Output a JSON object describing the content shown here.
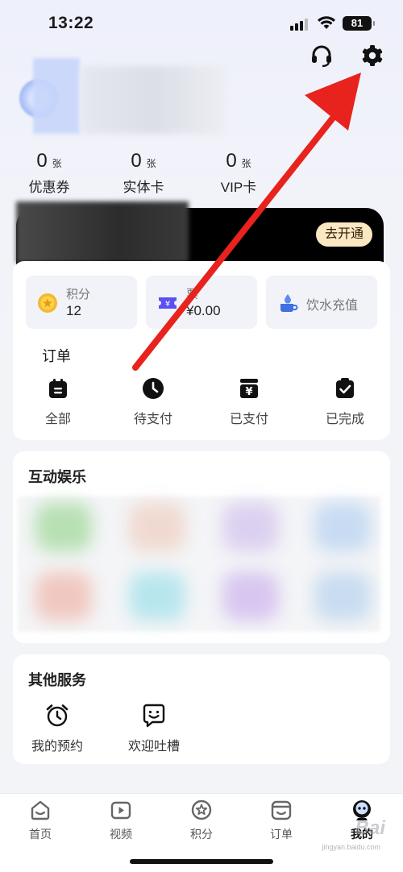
{
  "status_bar": {
    "time": "13:22",
    "battery": "81"
  },
  "stats": [
    {
      "num": "0",
      "unit": "张",
      "label": "优惠券"
    },
    {
      "num": "0",
      "unit": "张",
      "label": "实体卡"
    },
    {
      "num": "0",
      "unit": "张",
      "label": "VIP卡"
    }
  ],
  "vip": {
    "button": "去开通"
  },
  "tiles": [
    {
      "title": "积分",
      "value": "12"
    },
    {
      "title": "票",
      "value": "¥0.00"
    },
    {
      "title": "饮水充值"
    }
  ],
  "orders": {
    "title": "订单",
    "items": [
      {
        "label": "全部",
        "icon": "calendar-icon"
      },
      {
        "label": "待支付",
        "icon": "clock-icon"
      },
      {
        "label": "已支付",
        "icon": "yen-box-icon"
      },
      {
        "label": "已完成",
        "icon": "check-calendar-icon"
      }
    ]
  },
  "entertainment": {
    "title": "互动娱乐"
  },
  "services": {
    "title": "其他服务",
    "items": [
      {
        "label": "我的预约",
        "icon": "alarm-clock-icon"
      },
      {
        "label": "欢迎吐槽",
        "icon": "chat-smile-icon"
      }
    ]
  },
  "tabs": [
    {
      "label": "首页",
      "icon": "home-icon"
    },
    {
      "label": "视频",
      "icon": "video-icon"
    },
    {
      "label": "积分",
      "icon": "points-icon"
    },
    {
      "label": "订单",
      "icon": "order-icon"
    },
    {
      "label": "我的",
      "icon": "profile-icon",
      "active": true
    }
  ],
  "watermark": {
    "text": "Bai",
    "sub": "jingyan.baidu.com"
  },
  "colors": {
    "accent": "#5a4ff0",
    "vip_button": "#fbe7c1",
    "annotation": "#e8221d"
  }
}
